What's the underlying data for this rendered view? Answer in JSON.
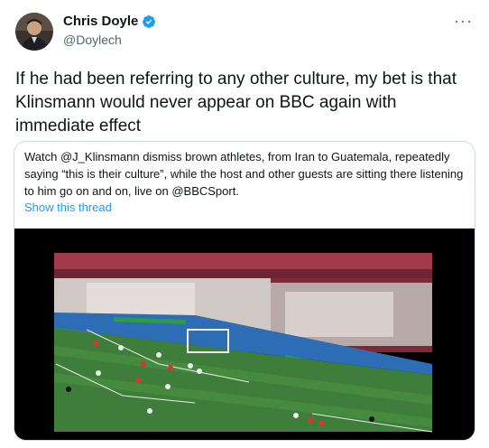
{
  "author": {
    "name": "Chris Doyle",
    "handle": "@Doylech"
  },
  "tweet": {
    "text": "If he had been referring to any other culture, my bet is that Klinsmann would never appear on BBC again with immediate effect"
  },
  "quoted": {
    "text": "Watch @J_Klinsmann dismiss brown athletes, from Iran to Guatemala, repeatedly saying “this is their culture”, while the host and other guests are sitting there listening to him go on and on, live on @BBCSport.",
    "show_thread": "Show this thread"
  },
  "icons": {
    "verified": "verified-badge-icon",
    "more": "more-options-icon"
  },
  "colors": {
    "accent": "#1d9bf0",
    "text": "#0f1419",
    "secondary": "#536471",
    "border": "#cfd9de",
    "pitch": "#3f7d3a"
  }
}
